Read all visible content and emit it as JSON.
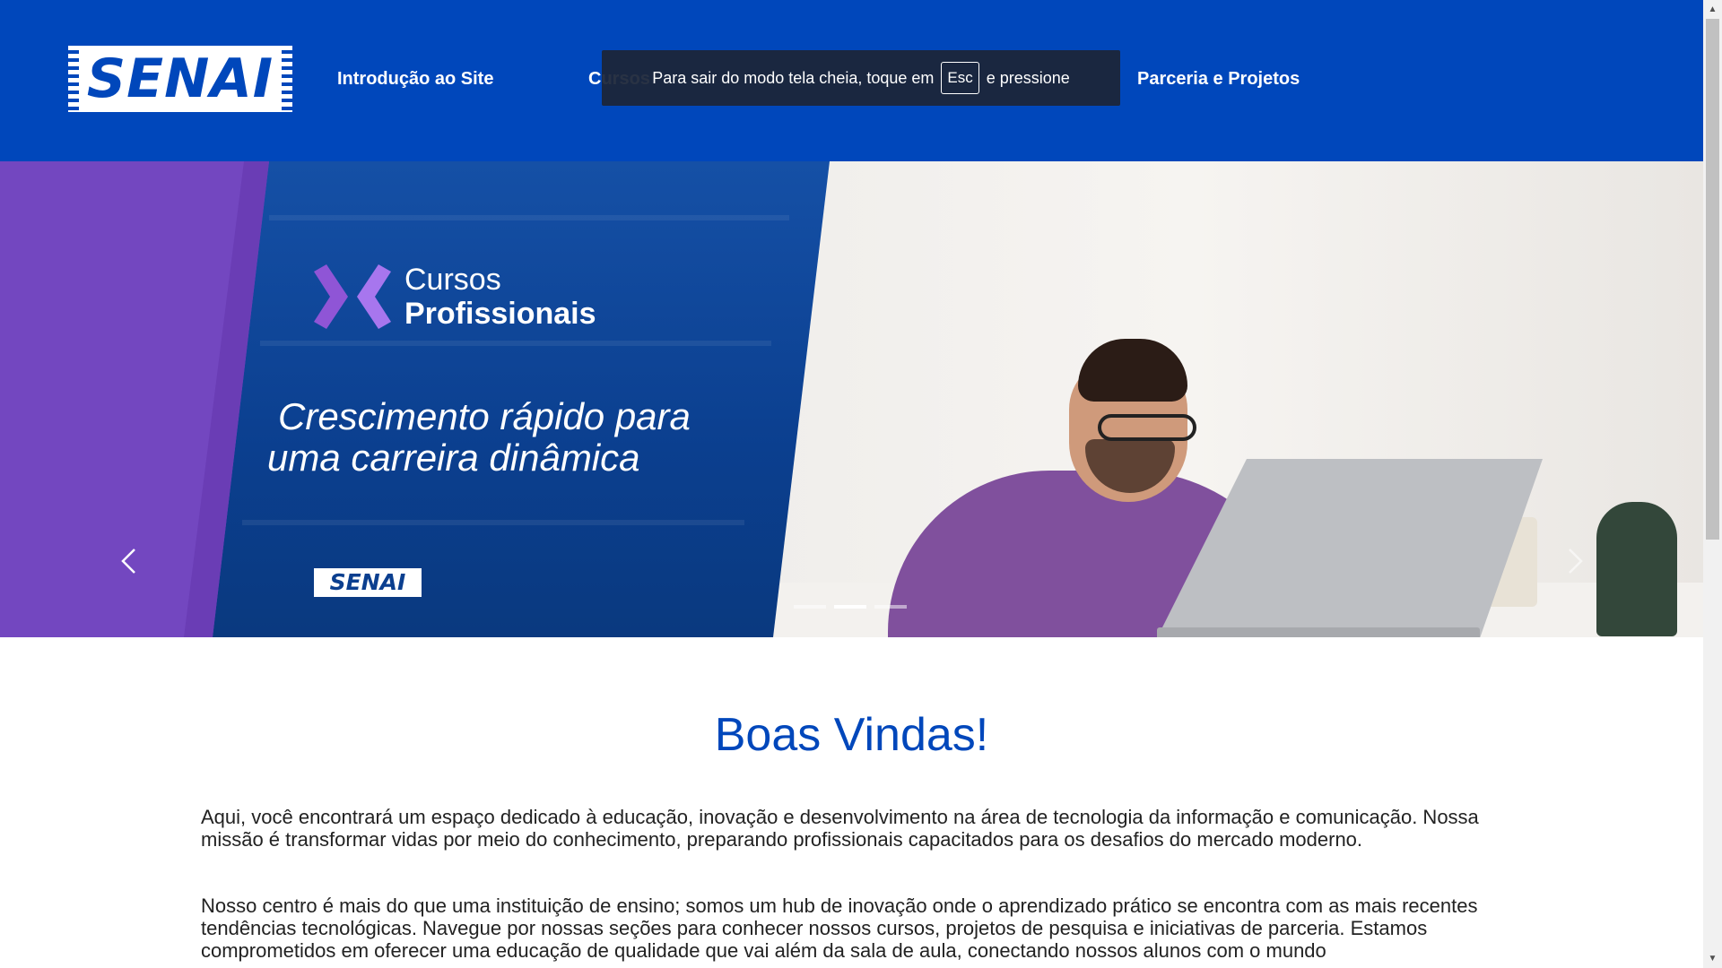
{
  "header": {
    "logo_text": "SENAI",
    "nav": [
      {
        "label": "Introdução ao Site"
      },
      {
        "label": "Cursos"
      },
      {
        "label": "Parceria e Projetos"
      }
    ],
    "brand_color": "#0047bb"
  },
  "fullscreen_toast": {
    "text_before": "Para sair do modo tela cheia, toque em",
    "key": "Esc",
    "text_after": "e pressione"
  },
  "carousel": {
    "slide": {
      "title_line1": "Cursos",
      "title_line2": "Profissionais",
      "headline_line1": "Crescimento rápido para",
      "headline_line2": "uma carreira dinâmica",
      "logo_text": "SENAI"
    },
    "indicators": [
      {
        "active": false
      },
      {
        "active": true
      },
      {
        "active": false
      }
    ],
    "prev_icon": "chevron-left-icon",
    "next_icon": "chevron-right-icon"
  },
  "content": {
    "heading": "Boas Vindas!",
    "paragraph1": "Aqui, você encontrará um espaço dedicado à educação, inovação e desenvolvimento na área de tecnologia da informação e comunicação. Nossa missão é transformar vidas por meio do conhecimento, preparando profissionais capacitados para os desafios do mercado moderno.",
    "paragraph2": "Nosso centro é mais do que uma instituição de ensino; somos um hub de inovação onde o aprendizado prático se encontra com as mais recentes tendências tecnológicas. Navegue por nossas seções para conhecer nossos cursos, projetos de pesquisa e iniciativas de parceria. Estamos comprometidos em oferecer uma educação de qualidade que vai além da sala de aula, conectando nossos alunos com o mundo"
  }
}
